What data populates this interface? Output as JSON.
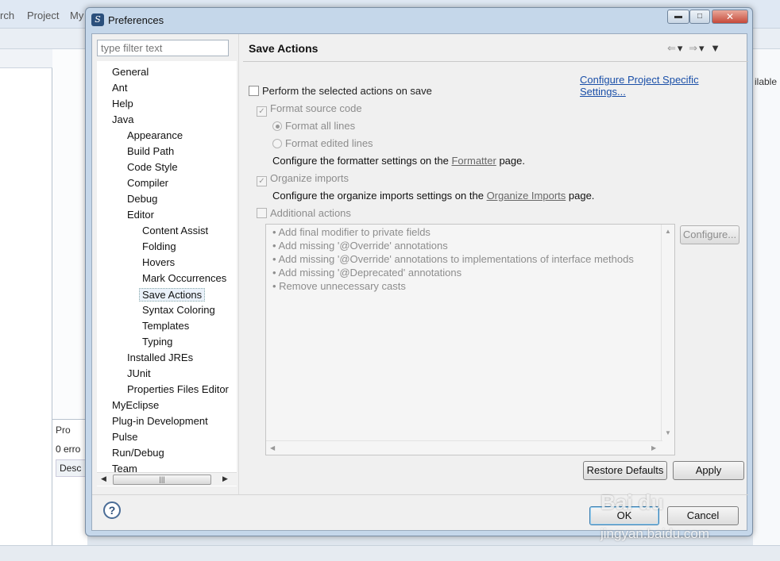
{
  "background": {
    "menu_items": [
      "rch",
      "Project",
      "My"
    ],
    "right_fragment": "ilable",
    "problems_tab": "Pro",
    "problems_errors": "0 erro",
    "problems_desc": "Desc"
  },
  "dialog": {
    "title": "Preferences",
    "filter_placeholder": "type filter text",
    "tree": [
      {
        "label": "General",
        "level": 0
      },
      {
        "label": "Ant",
        "level": 0
      },
      {
        "label": "Help",
        "level": 0
      },
      {
        "label": "Java",
        "level": 0
      },
      {
        "label": "Appearance",
        "level": 1
      },
      {
        "label": "Build Path",
        "level": 1
      },
      {
        "label": "Code Style",
        "level": 1
      },
      {
        "label": "Compiler",
        "level": 1
      },
      {
        "label": "Debug",
        "level": 1
      },
      {
        "label": "Editor",
        "level": 1
      },
      {
        "label": "Content Assist",
        "level": 2
      },
      {
        "label": "Folding",
        "level": 2
      },
      {
        "label": "Hovers",
        "level": 2
      },
      {
        "label": "Mark Occurrences",
        "level": 2
      },
      {
        "label": "Save Actions",
        "level": 2,
        "selected": true
      },
      {
        "label": "Syntax Coloring",
        "level": 2
      },
      {
        "label": "Templates",
        "level": 2
      },
      {
        "label": "Typing",
        "level": 2
      },
      {
        "label": "Installed JREs",
        "level": 1
      },
      {
        "label": "JUnit",
        "level": 1
      },
      {
        "label": "Properties Files Editor",
        "level": 1
      },
      {
        "label": "MyEclipse",
        "level": 0
      },
      {
        "label": "Plug-in Development",
        "level": 0
      },
      {
        "label": "Pulse",
        "level": 0
      },
      {
        "label": "Run/Debug",
        "level": 0
      },
      {
        "label": "Team",
        "level": 0
      }
    ],
    "page": {
      "title": "Save Actions",
      "project_link": "Configure Project Specific Settings...",
      "perform_on_save": "Perform the selected actions on save",
      "format_source": "Format source code",
      "format_all": "Format all lines",
      "format_edited": "Format edited lines",
      "formatter_prefix": "Configure the formatter settings on the",
      "formatter_link": "Formatter",
      "formatter_suffix": "page.",
      "organize_imports": "Organize imports",
      "organize_prefix": "Configure the organize imports settings on the",
      "organize_link": "Organize Imports",
      "organize_suffix": "page.",
      "additional_actions": "Additional actions",
      "actions": [
        "Add final modifier to private fields",
        "Add missing '@Override' annotations",
        "Add missing '@Override' annotations to implementations of interface methods",
        "Add missing '@Deprecated' annotations",
        "Remove unnecessary casts"
      ],
      "configure_btn": "Configure...",
      "restore_defaults_btn": "Restore Defaults",
      "apply_btn": "Apply"
    },
    "ok_btn": "OK",
    "cancel_btn": "Cancel"
  },
  "watermark": {
    "brand": "Bai du",
    "url": "jingyan.baidu.com"
  }
}
